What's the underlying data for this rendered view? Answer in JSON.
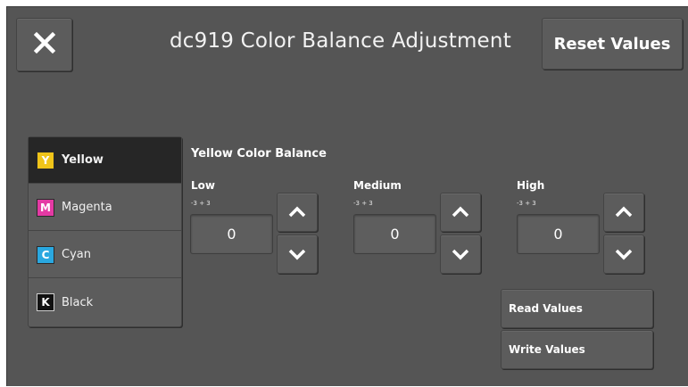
{
  "header": {
    "title": "dc919 Color Balance Adjustment",
    "reset_label": "Reset Values",
    "close_icon": "close-icon"
  },
  "colors": [
    {
      "letter": "Y",
      "label": "Yellow",
      "swatch": "#f0c419",
      "selected": true
    },
    {
      "letter": "M",
      "label": "Magenta",
      "swatch": "#e43aa4",
      "selected": false
    },
    {
      "letter": "C",
      "label": "Cyan",
      "swatch": "#2aa8e0",
      "selected": false
    },
    {
      "letter": "K",
      "label": "Black",
      "swatch": "#111111",
      "selected": false
    }
  ],
  "balance": {
    "title": "Yellow Color Balance",
    "groups": [
      {
        "label": "Low",
        "range": "-3 + 3",
        "value": "0"
      },
      {
        "label": "Medium",
        "range": "-3 + 3",
        "value": "0"
      },
      {
        "label": "High",
        "range": "-3 + 3",
        "value": "0"
      }
    ]
  },
  "actions": {
    "read_label": "Read Values",
    "write_label": "Write Values"
  },
  "theme": {
    "panel": "#555555",
    "selected_item": "#262626"
  }
}
